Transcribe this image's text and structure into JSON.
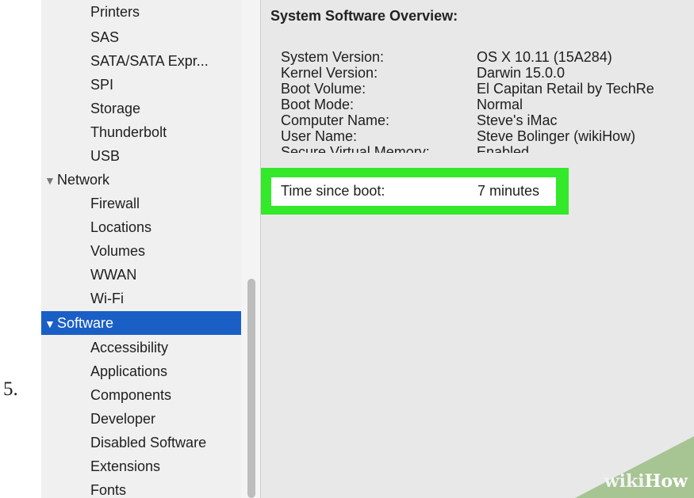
{
  "step_number": "5.",
  "sidebar": {
    "items": [
      {
        "label": "Printers",
        "kind": "sub"
      },
      {
        "label": "SAS",
        "kind": "sub"
      },
      {
        "label": "SATA/SATA Expr...",
        "kind": "sub"
      },
      {
        "label": "SPI",
        "kind": "sub"
      },
      {
        "label": "Storage",
        "kind": "sub"
      },
      {
        "label": "Thunderbolt",
        "kind": "sub"
      },
      {
        "label": "USB",
        "kind": "sub"
      },
      {
        "label": "Network",
        "kind": "group"
      },
      {
        "label": "Firewall",
        "kind": "sub"
      },
      {
        "label": "Locations",
        "kind": "sub"
      },
      {
        "label": "Volumes",
        "kind": "sub"
      },
      {
        "label": "WWAN",
        "kind": "sub"
      },
      {
        "label": "Wi-Fi",
        "kind": "sub"
      },
      {
        "label": "Software",
        "kind": "group",
        "selected": true
      },
      {
        "label": "Accessibility",
        "kind": "sub"
      },
      {
        "label": "Applications",
        "kind": "sub"
      },
      {
        "label": "Components",
        "kind": "sub"
      },
      {
        "label": "Developer",
        "kind": "sub"
      },
      {
        "label": "Disabled Software",
        "kind": "sub"
      },
      {
        "label": "Extensions",
        "kind": "sub"
      },
      {
        "label": "Fonts",
        "kind": "sub"
      }
    ],
    "selected_color": "#1a5fc6"
  },
  "content": {
    "heading": "System Software Overview:",
    "rows": [
      {
        "key": "System Version:",
        "value": "OS X 10.11 (15A284)"
      },
      {
        "key": "Kernel Version:",
        "value": "Darwin 15.0.0"
      },
      {
        "key": "Boot Volume:",
        "value": "El Capitan Retail by TechRe"
      },
      {
        "key": "Boot Mode:",
        "value": "Normal"
      },
      {
        "key": "Computer Name:",
        "value": "Steve's iMac"
      },
      {
        "key": "User Name:",
        "value": "Steve Bolinger (wikiHow)"
      },
      {
        "key": "Secure Virtual Memory:",
        "value": "Enabled"
      }
    ],
    "highlighted": {
      "key": "Time since boot:",
      "value": "7 minutes"
    },
    "highlight_color": "#34e82a"
  },
  "watermark": {
    "part1": "wiki",
    "part2": "How"
  },
  "icons": {
    "expanded": "disclosure-triangle-down-icon"
  }
}
